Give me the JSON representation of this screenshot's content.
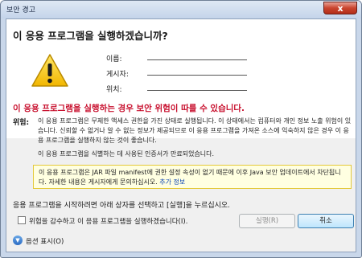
{
  "window": {
    "title": "보안 경고",
    "close_glyph": "x"
  },
  "dialog": {
    "heading": "이 응용 프로그램을 실행하겠습니까?",
    "fields": [
      {
        "label": "이름:"
      },
      {
        "label": "게시자:"
      },
      {
        "label": "위치:"
      }
    ],
    "risk_title": "이 응용 프로그램을 실행하는 경우 보안 위험이 따를 수 있습니다.",
    "risk_label": "위험:",
    "risk_body": "이 응용 프로그램은 무제한 액세스 권한을 가진 상태로 실행됩니다. 이 상태에서는 컴퓨터와 개인 정보 노출 위험이 있습니다. 신뢰할 수 없거나 알 수 없는 정보가 제공되므로 이 응용 프로그램을 가져온 소스에 익숙하지 않은 경우 이 응용 프로그램을 실행하지 않는 것이 좋습니다.",
    "cert_note": "이 응용 프로그램을 식별하는 데 사용된 인증서가 만료되었습니다.",
    "notice_text": "이 응용 프로그램은 JAR 파일 manifest에 권한 설정 속성이 없기 때문에 이후 Java 보안 업데이트에서 차단됩니다. 자세한 내용은 게시자에게 문의하십시오.",
    "notice_link": "추가 정보",
    "instruction": "응용 프로그램을 시작하려면 아래 상자를 선택하고 [실행]을 누르십시오.",
    "accept_label": "위험을 감수하고 이 응용 프로그램을 실행하겠습니다(I).",
    "run_button": "실행(R)",
    "cancel_button": "취소",
    "options_label": "옵션 표시(O)"
  },
  "colors": {
    "warning_red": "#c8102e",
    "link_blue": "#0b45b5",
    "notice_bg": "#ffffe1"
  },
  "icons": {
    "warning": "warning-icon",
    "options": "chevron-down-icon"
  }
}
